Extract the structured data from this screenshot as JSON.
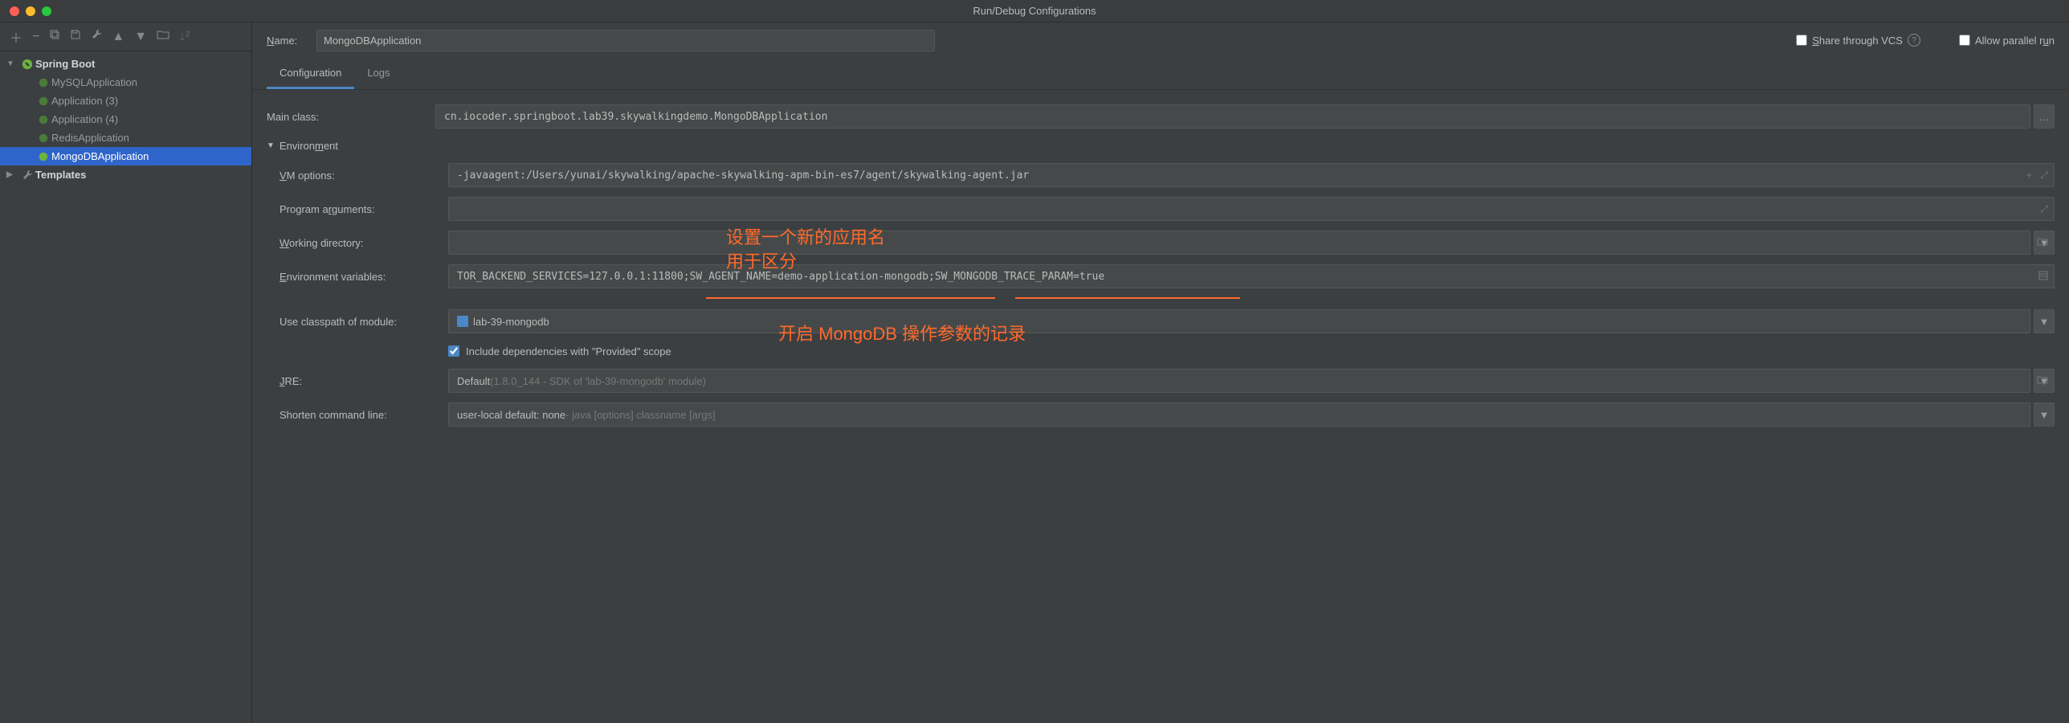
{
  "window": {
    "title": "Run/Debug Configurations"
  },
  "sidebar": {
    "groups": [
      {
        "label": "Spring Boot",
        "expanded": true
      },
      {
        "label": "Templates",
        "expanded": false
      }
    ],
    "items": [
      {
        "label": "MySQLApplication",
        "selected": false
      },
      {
        "label": "Application (3)",
        "selected": false
      },
      {
        "label": "Application (4)",
        "selected": false
      },
      {
        "label": "RedisApplication",
        "selected": false
      },
      {
        "label": "MongoDBApplication",
        "selected": true
      }
    ]
  },
  "nameRow": {
    "label_name_prefix": "N",
    "label_name_rest": "ame:",
    "value": "MongoDBApplication",
    "share_prefix": "S",
    "share_rest": "hare through VCS",
    "parallel_prefix": "Allow parallel r",
    "parallel_u": "u",
    "parallel_rest": "n"
  },
  "tabs": [
    {
      "label": "Configuration",
      "active": true
    },
    {
      "label": "Logs",
      "active": false
    }
  ],
  "form": {
    "mainClass": {
      "label": "Main class:",
      "value": "cn.iocoder.springboot.lab39.skywalkingdemo.MongoDBApplication"
    },
    "envSection": {
      "label_pre": "Environ",
      "label_u": "m",
      "label_post": "ent"
    },
    "vmOptions": {
      "label_u": "V",
      "label_rest": "M options:",
      "value": "-javaagent:/Users/yunai/skywalking/apache-skywalking-apm-bin-es7/agent/skywalking-agent.jar"
    },
    "programArgs": {
      "label_pre": "Program a",
      "label_u": "r",
      "label_post": "guments:",
      "value": ""
    },
    "workingDir": {
      "label_u": "W",
      "label_rest": "orking directory:",
      "value": ""
    },
    "envVars": {
      "label_u": "E",
      "label_rest": "nvironment variables:",
      "value": "TOR_BACKEND_SERVICES=127.0.0.1:11800;SW_AGENT_NAME=demo-application-mongodb;SW_MONGODB_TRACE_PARAM=true"
    },
    "classpath": {
      "label": "Use classpath of module:",
      "value": "lab-39-mongodb"
    },
    "includeProvided": {
      "label": "Include dependencies with \"Provided\" scope",
      "checked": true
    },
    "jre": {
      "label_u": "J",
      "label_rest": "RE:",
      "value": "Default",
      "hint": " (1.8.0_144 - SDK of 'lab-39-mongodb' module)"
    },
    "shorten": {
      "label": "Shorten command line:",
      "value": "user-local default: none",
      "hint": " - java [options] classname [args]"
    }
  },
  "annotations": {
    "line1": "设置一个新的应用名",
    "line2": "用于区分",
    "line3": "开启 MongoDB 操作参数的记录"
  }
}
